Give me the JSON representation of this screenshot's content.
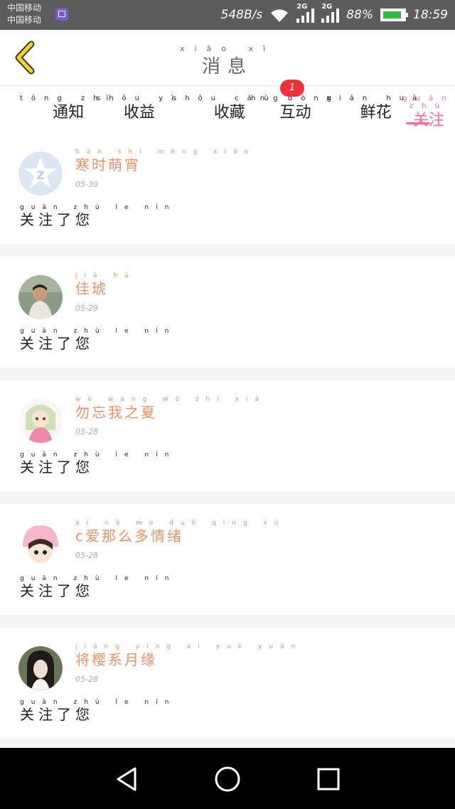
{
  "status_bar": {
    "carrier_line1": "中国移动",
    "carrier_line2": "中国移动",
    "speed": "548B/s",
    "net1": "2G",
    "net2": "2G",
    "battery": "88%",
    "battery_level": 0.88,
    "time": "18:59"
  },
  "header": {
    "title": "消息",
    "title_pinyin": "xiāo xī"
  },
  "tabs": [
    {
      "label": "通知",
      "pinyin": "tōng zhī"
    },
    {
      "label": "收益",
      "pinyin": "shōu yì"
    },
    {
      "label": "收藏",
      "pinyin": "shōu cáng"
    },
    {
      "label": "互动",
      "pinyin": "hù dòng"
    },
    {
      "label": "鲜花",
      "pinyin": "xiān huā"
    },
    {
      "label": "关注",
      "pinyin": "guān zhù"
    }
  ],
  "active_tab": "关注",
  "badge_count": "1",
  "messages": [
    {
      "name": "寒时萌宵",
      "name_pinyin": "hán shí méng xiāo",
      "date": "05-30",
      "action": "关注了您",
      "action_pinyin": "guān zhù le nín",
      "avatar": "qq-star-avatar"
    },
    {
      "name": "佳琥",
      "name_pinyin": "jiā hǔ",
      "date": "05-29",
      "action": "关注了您",
      "action_pinyin": "guān zhù le nín",
      "avatar": "child-photo-avatar"
    },
    {
      "name": "勿忘我之夏",
      "name_pinyin": "wù wàng wǒ zhī xià",
      "date": "05-28",
      "action": "关注了您",
      "action_pinyin": "guān zhù le nín",
      "avatar": "anime-girl-avatar"
    },
    {
      "name": "c爱那么多情绪",
      "name_pinyin": "ài nà me duō qíng xù",
      "date": "05-28",
      "action": "关注了您",
      "action_pinyin": "guān zhù le nín",
      "avatar": "cartoon-pink-hat-avatar"
    },
    {
      "name": "将樱系月缘",
      "name_pinyin": "jiāng yīng xì yuè yuán",
      "date": "05-28",
      "action": "关注了您",
      "action_pinyin": "guān zhù le nín",
      "avatar": "actress-photo-avatar"
    }
  ],
  "colors": {
    "accent_pink": "#e8719f",
    "name_orange": "#e8926a",
    "badge_red": "#f0313c",
    "back_yellow": "#f2d531"
  }
}
